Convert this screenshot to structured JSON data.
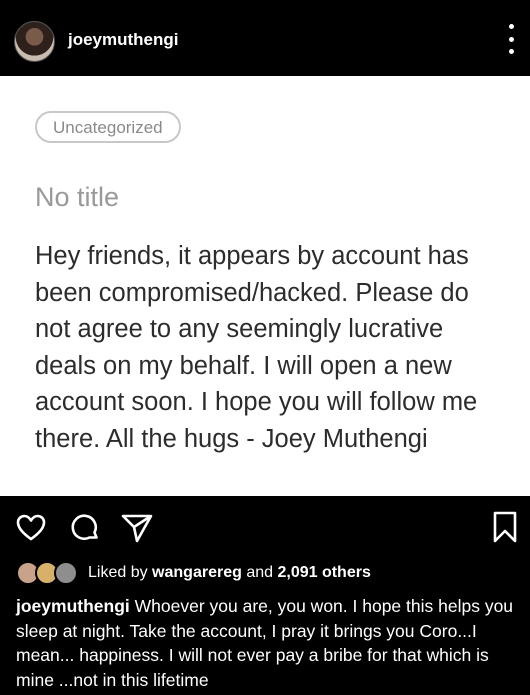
{
  "header": {
    "username": "joeymuthengi"
  },
  "post": {
    "category_chip": "Uncategorized",
    "title_placeholder": "No title",
    "body": "Hey friends, it appears by account has been compromised/hacked. Please do not agree to any  seemingly lucrative deals on my behalf. I will open a new account soon. I hope you will follow me there. All the hugs - Joey Muthengi"
  },
  "actions": {
    "icons": [
      "heart-icon",
      "comment-icon",
      "share-icon",
      "bookmark-icon"
    ]
  },
  "likes": {
    "prefix": "Liked by",
    "liker": "wangarereg",
    "and": "and",
    "others": "2,091 others"
  },
  "caption": {
    "username": "joeymuthengi",
    "text": " Whoever you are, you won. I hope this helps you sleep at night. Take the account, I pray it brings you Coro...I mean... happiness. I will not ever pay a bribe for that which is mine ...not in this lifetime"
  },
  "colors": {
    "background": "#000000",
    "post_card": "#ffffff",
    "text": "#ffffff"
  }
}
